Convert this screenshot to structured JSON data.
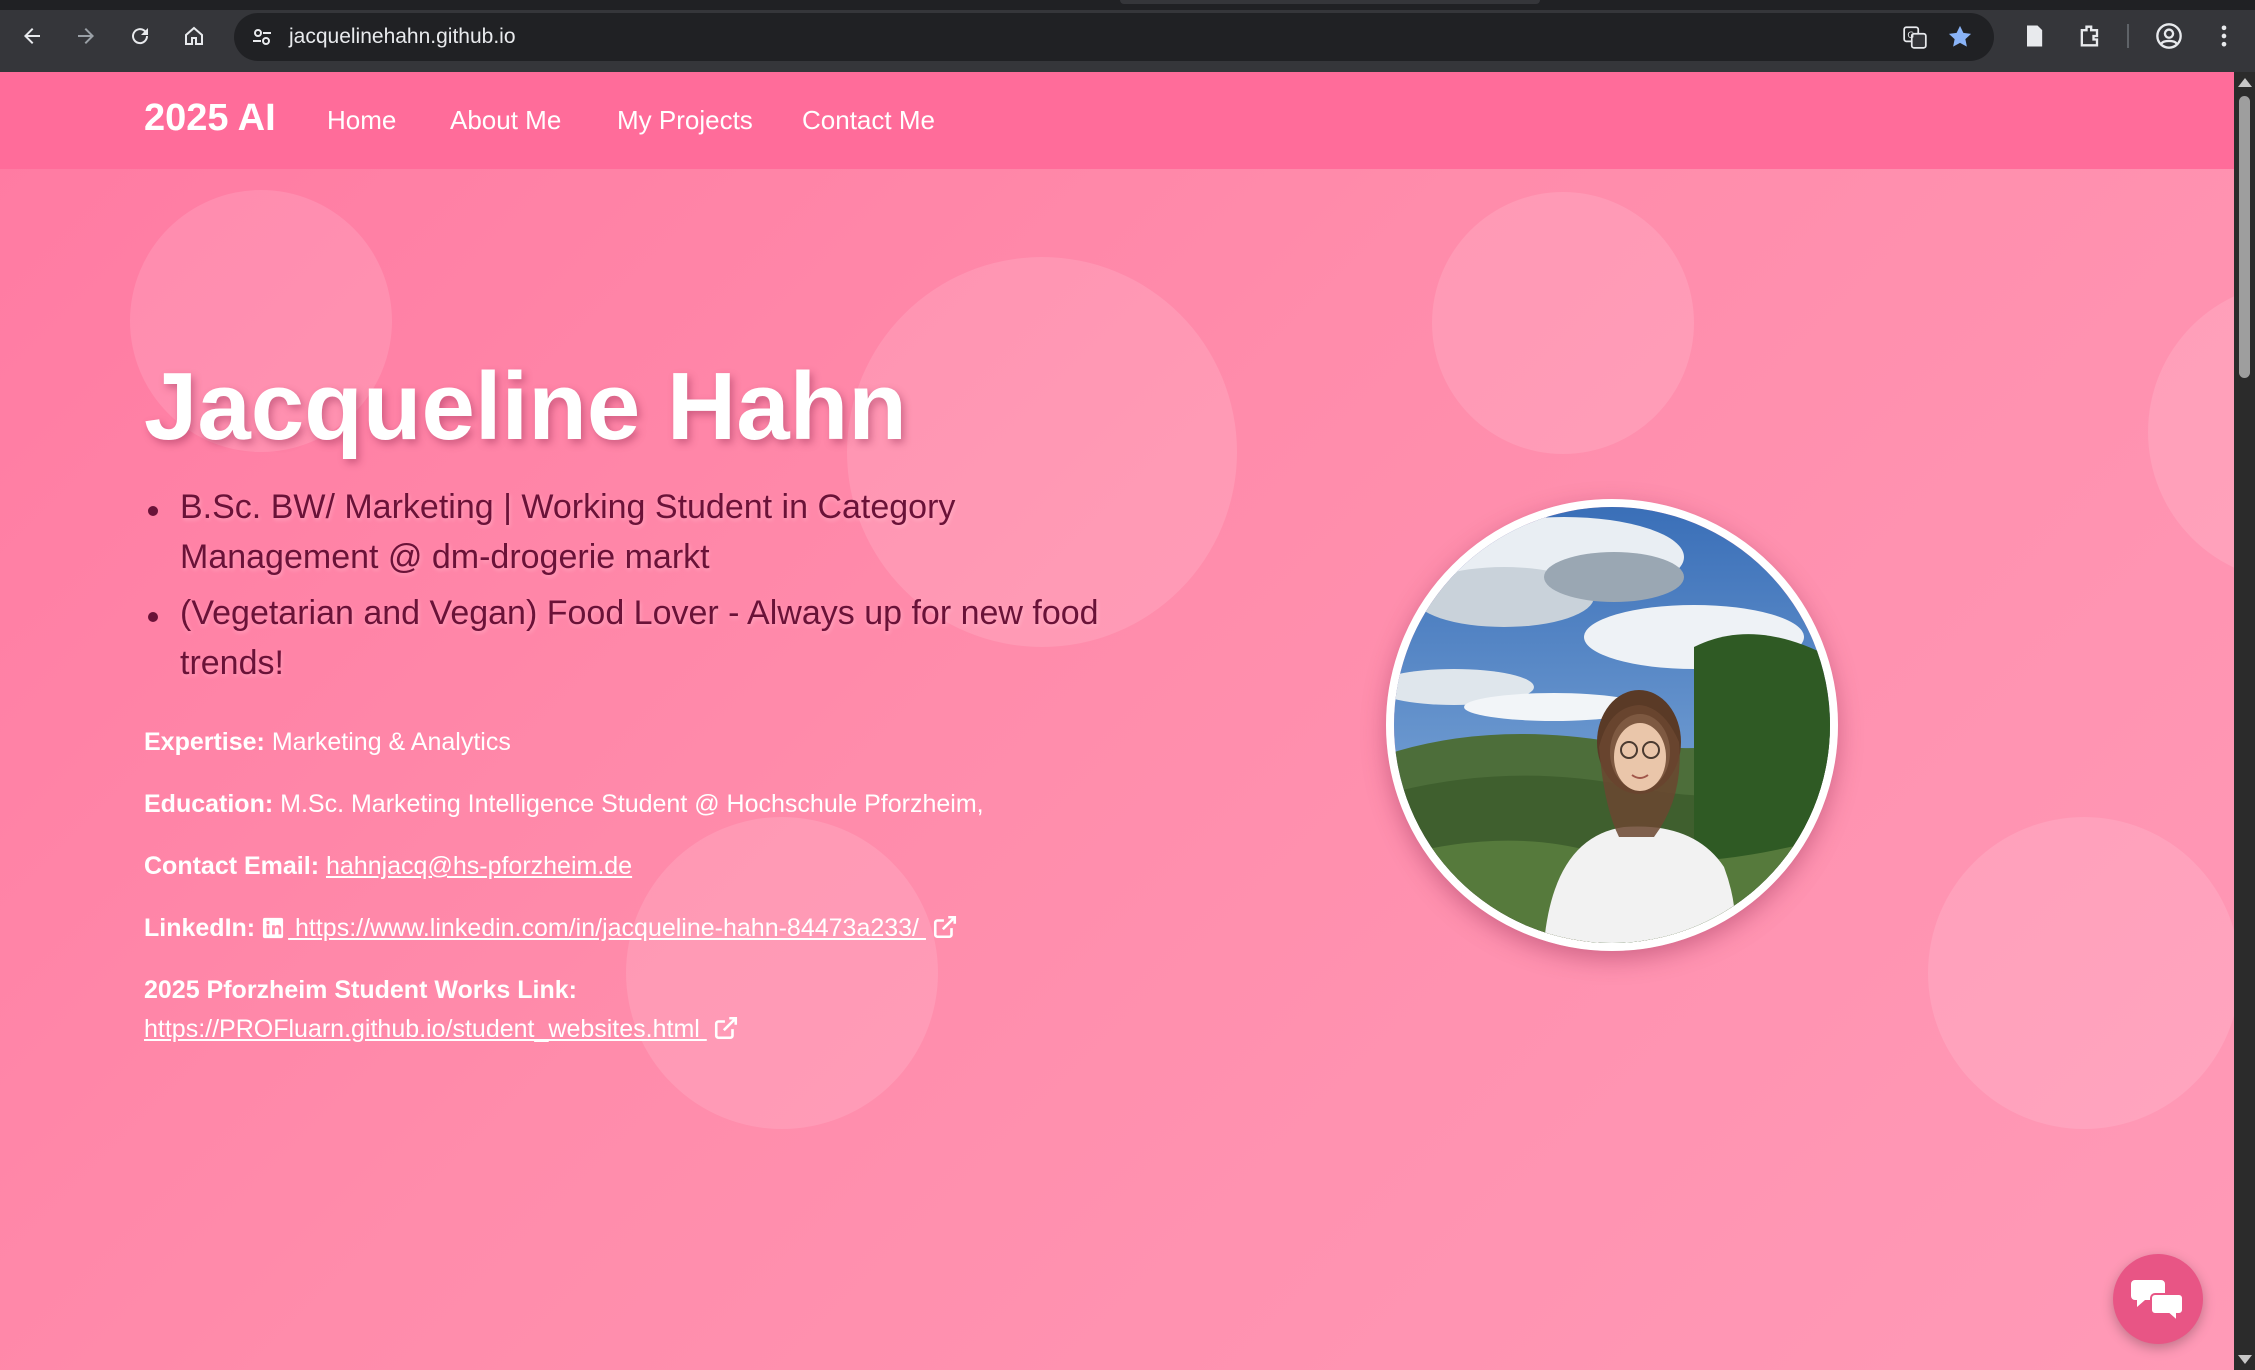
{
  "browser": {
    "url": "jacquelinehahn.github.io",
    "icons": [
      "back-icon",
      "forward-icon",
      "reload-icon",
      "home-icon",
      "site-settings-icon",
      "translate-icon",
      "bookmark-star-icon",
      "reading-list-icon",
      "extensions-icon",
      "profile-icon",
      "menu-icon"
    ]
  },
  "site": {
    "brand": "2025 AI",
    "nav": [
      "Home",
      "About Me",
      "My Projects",
      "Contact Me"
    ]
  },
  "hero": {
    "name": "Jacqueline Hahn",
    "bullets": [
      "B.Sc. BW/ Marketing | Working Student in Category Management @ dm-drogerie markt",
      "(Vegetarian and Vegan) Food Lover - Always up for new food trends!"
    ],
    "expertise_label": "Expertise:",
    "expertise_value": "Marketing & Analytics",
    "education_label": "Education:",
    "education_value": "M.Sc. Marketing Intelligence Student @ Hochschule Pforzheim,",
    "email_label": "Contact Email:",
    "email_value": "hahnjacq@hs-pforzheim.de",
    "linkedin_label": "LinkedIn:",
    "linkedin_value": " https://www.linkedin.com/in/jacqueline-hahn-84473a233/ ",
    "works_label": "2025 Pforzheim Student Works Link:",
    "works_value": "https://PROFluarn.github.io/student_websites.html "
  },
  "colors": {
    "nav_bg": "#ff6c9a",
    "page_bg": "#ff8cab",
    "bullet_text": "#6a1238",
    "chat_button": "#e85585"
  }
}
